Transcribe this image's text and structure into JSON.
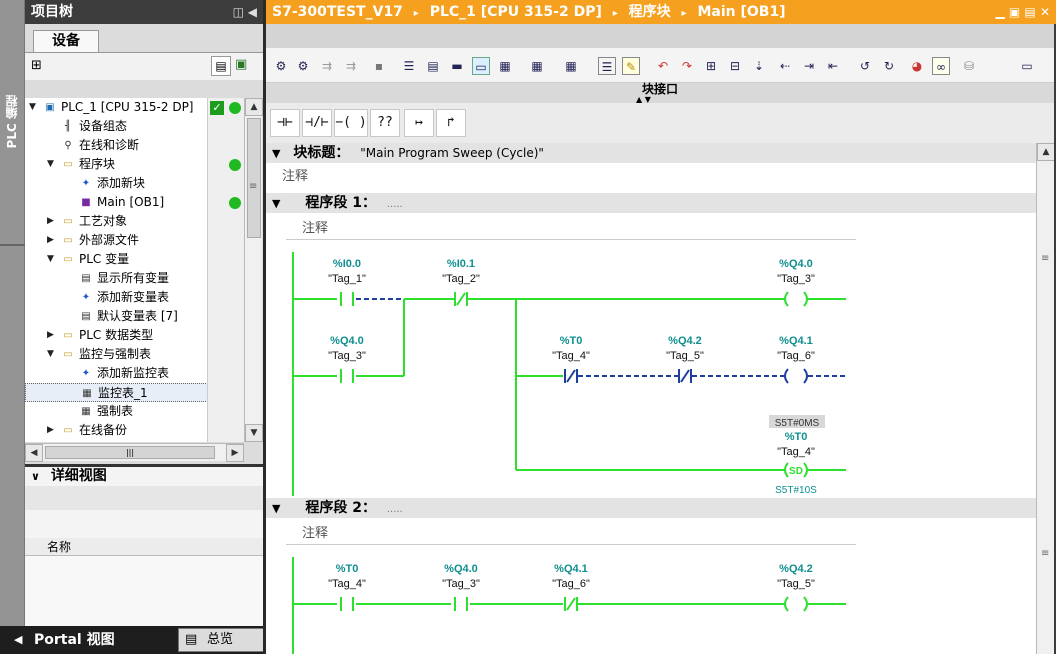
{
  "sidebar_vertical_tab": "PLC 编程",
  "project_tree": {
    "title": "项目树",
    "tab": "设备",
    "items": [
      {
        "label": "PLC_1 [CPU 315-2 DP]",
        "icon": "plc-icon",
        "level": 0,
        "expanded": true
      },
      {
        "label": "设备组态",
        "icon": "device-config-icon",
        "level": 1
      },
      {
        "label": "在线和诊断",
        "icon": "diagnostics-icon",
        "level": 1
      },
      {
        "label": "程序块",
        "icon": "folder-icon",
        "level": 1,
        "expanded": true
      },
      {
        "label": "添加新块",
        "icon": "add-block-icon",
        "level": 2
      },
      {
        "label": "Main [OB1]",
        "icon": "ob-block-icon",
        "level": 2
      },
      {
        "label": "工艺对象",
        "icon": "folder-icon",
        "level": 1,
        "expanded": false
      },
      {
        "label": "外部源文件",
        "icon": "folder-icon",
        "level": 1,
        "expanded": false
      },
      {
        "label": "PLC 变量",
        "icon": "folder-icon",
        "level": 1,
        "expanded": true
      },
      {
        "label": "显示所有变量",
        "icon": "tag-table-icon",
        "level": 2
      },
      {
        "label": "添加新变量表",
        "icon": "add-table-icon",
        "level": 2
      },
      {
        "label": "默认变量表 [7]",
        "icon": "tag-table-icon",
        "level": 2
      },
      {
        "label": "PLC 数据类型",
        "icon": "folder-icon",
        "level": 1,
        "expanded": false
      },
      {
        "label": "监控与强制表",
        "icon": "folder-icon",
        "level": 1,
        "expanded": true
      },
      {
        "label": "添加新监控表",
        "icon": "add-table-icon",
        "level": 2
      },
      {
        "label": "监控表_1",
        "icon": "watch-table-icon",
        "level": 2
      },
      {
        "label": "强制表",
        "icon": "force-table-icon",
        "level": 2
      },
      {
        "label": "在线备份",
        "icon": "folder-icon",
        "level": 1,
        "expanded": false
      }
    ]
  },
  "detail_view": {
    "title": "详细视图",
    "column": "名称"
  },
  "bottom_bar": {
    "portal": "Portal 视图",
    "overview": "总览"
  },
  "breadcrumb": [
    "S7-300TEST_V17",
    "PLC_1 [CPU 315-2 DP]",
    "程序块",
    "Main [OB1]"
  ],
  "interface_label": "块接口",
  "ladder_toolbar": [
    "⊣⊢",
    "⊣/⊢",
    "−( )−",
    "??",
    "↦",
    "↱"
  ],
  "block": {
    "title_label": "块标题：",
    "title_value": "\"Main Program Sweep (Cycle)\"",
    "comment": "注释"
  },
  "networks": [
    {
      "label": "程序段 1：",
      "dots": ".....",
      "comment": "注释",
      "elements": [
        {
          "addr": "%I0.0",
          "tag": "\"Tag_1\"",
          "type": "NO contact"
        },
        {
          "addr": "%I0.1",
          "tag": "\"Tag_2\"",
          "type": "NC contact"
        },
        {
          "addr": "%Q4.0",
          "tag": "\"Tag_3\"",
          "type": "coil"
        },
        {
          "addr": "%Q4.0",
          "tag": "\"Tag_3\"",
          "type": "NO contact"
        },
        {
          "addr": "%T0",
          "tag": "\"Tag_4\"",
          "type": "NC contact"
        },
        {
          "addr": "%Q4.2",
          "tag": "\"Tag_5\"",
          "type": "NC contact"
        },
        {
          "addr": "%Q4.1",
          "tag": "\"Tag_6\"",
          "type": "coil"
        },
        {
          "addr": "%T0",
          "tag": "\"Tag_4\"",
          "type": "SD coil",
          "preset": "S5T#0MS",
          "time": "S5T#10S",
          "coil_label": "SD"
        }
      ]
    },
    {
      "label": "程序段 2：",
      "dots": ".....",
      "comment": "注释",
      "elements": [
        {
          "addr": "%T0",
          "tag": "\"Tag_4\"",
          "type": "NO contact"
        },
        {
          "addr": "%Q4.0",
          "tag": "\"Tag_3\"",
          "type": "NO contact"
        },
        {
          "addr": "%Q4.1",
          "tag": "\"Tag_6\"",
          "type": "NC contact"
        },
        {
          "addr": "%Q4.2",
          "tag": "\"Tag_5\"",
          "type": "coil"
        }
      ]
    }
  ],
  "colors": {
    "accent": "#f5a01e",
    "energized": "#2ee02e",
    "teal": "#0f8f8f",
    "dashed": "#1f3fa0"
  }
}
